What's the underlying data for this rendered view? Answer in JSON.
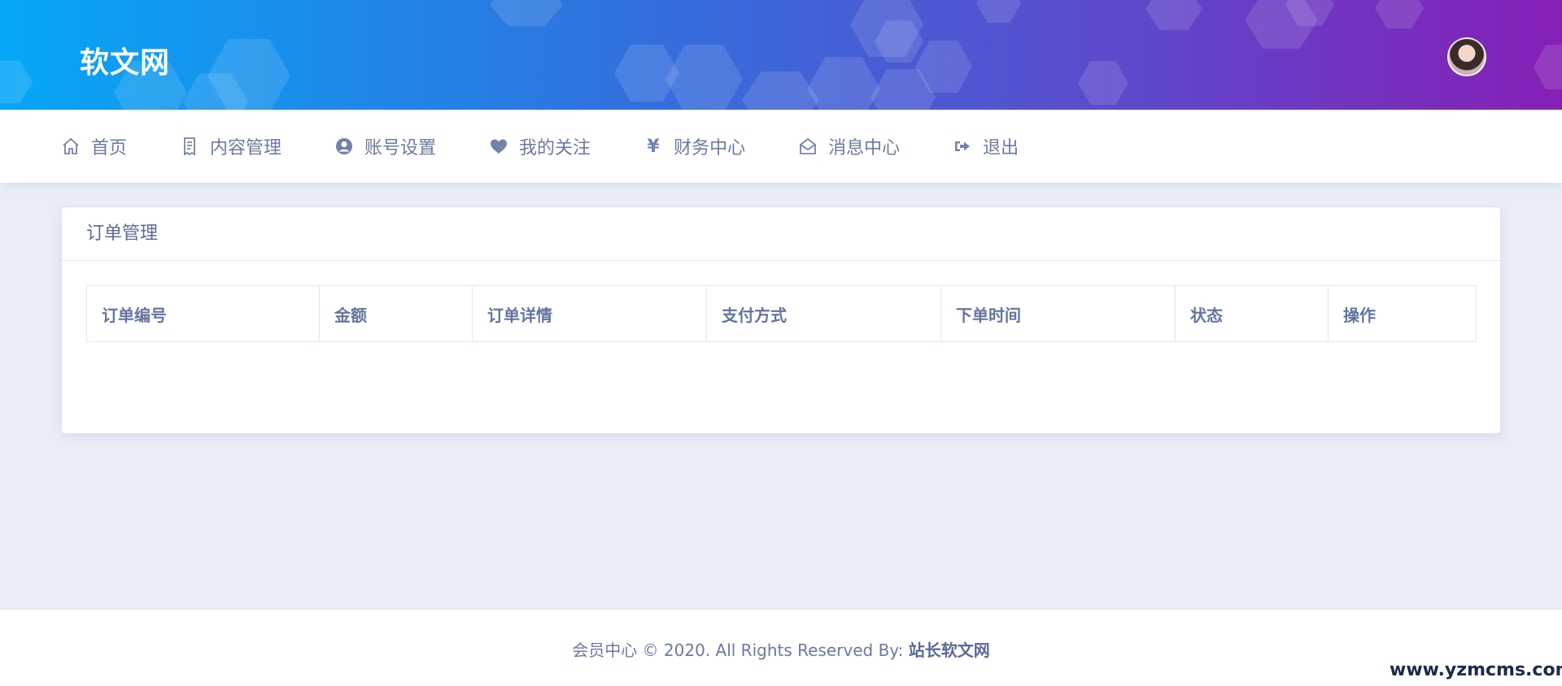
{
  "header": {
    "logo": "软文网",
    "colors": {
      "gradient_start": "#06a7f7",
      "gradient_end": "#861fb6"
    }
  },
  "nav": {
    "items": [
      {
        "label": "首页",
        "icon": "home-icon"
      },
      {
        "label": "内容管理",
        "icon": "document-icon"
      },
      {
        "label": "账号设置",
        "icon": "user-circle-icon"
      },
      {
        "label": "我的关注",
        "icon": "heart-icon"
      },
      {
        "label": "财务中心",
        "icon": "yen-icon"
      },
      {
        "label": "消息中心",
        "icon": "envelope-open-icon"
      },
      {
        "label": "退出",
        "icon": "sign-out-icon"
      }
    ]
  },
  "orders": {
    "title": "订单管理",
    "columns": [
      "订单编号",
      "金额",
      "订单详情",
      "支付方式",
      "下单时间",
      "状态",
      "操作"
    ]
  },
  "footer": {
    "text": "会员中心 © 2020. All Rights Reserved By: ",
    "site": "站长软文网"
  },
  "watermark": "www.yzmcms.com"
}
